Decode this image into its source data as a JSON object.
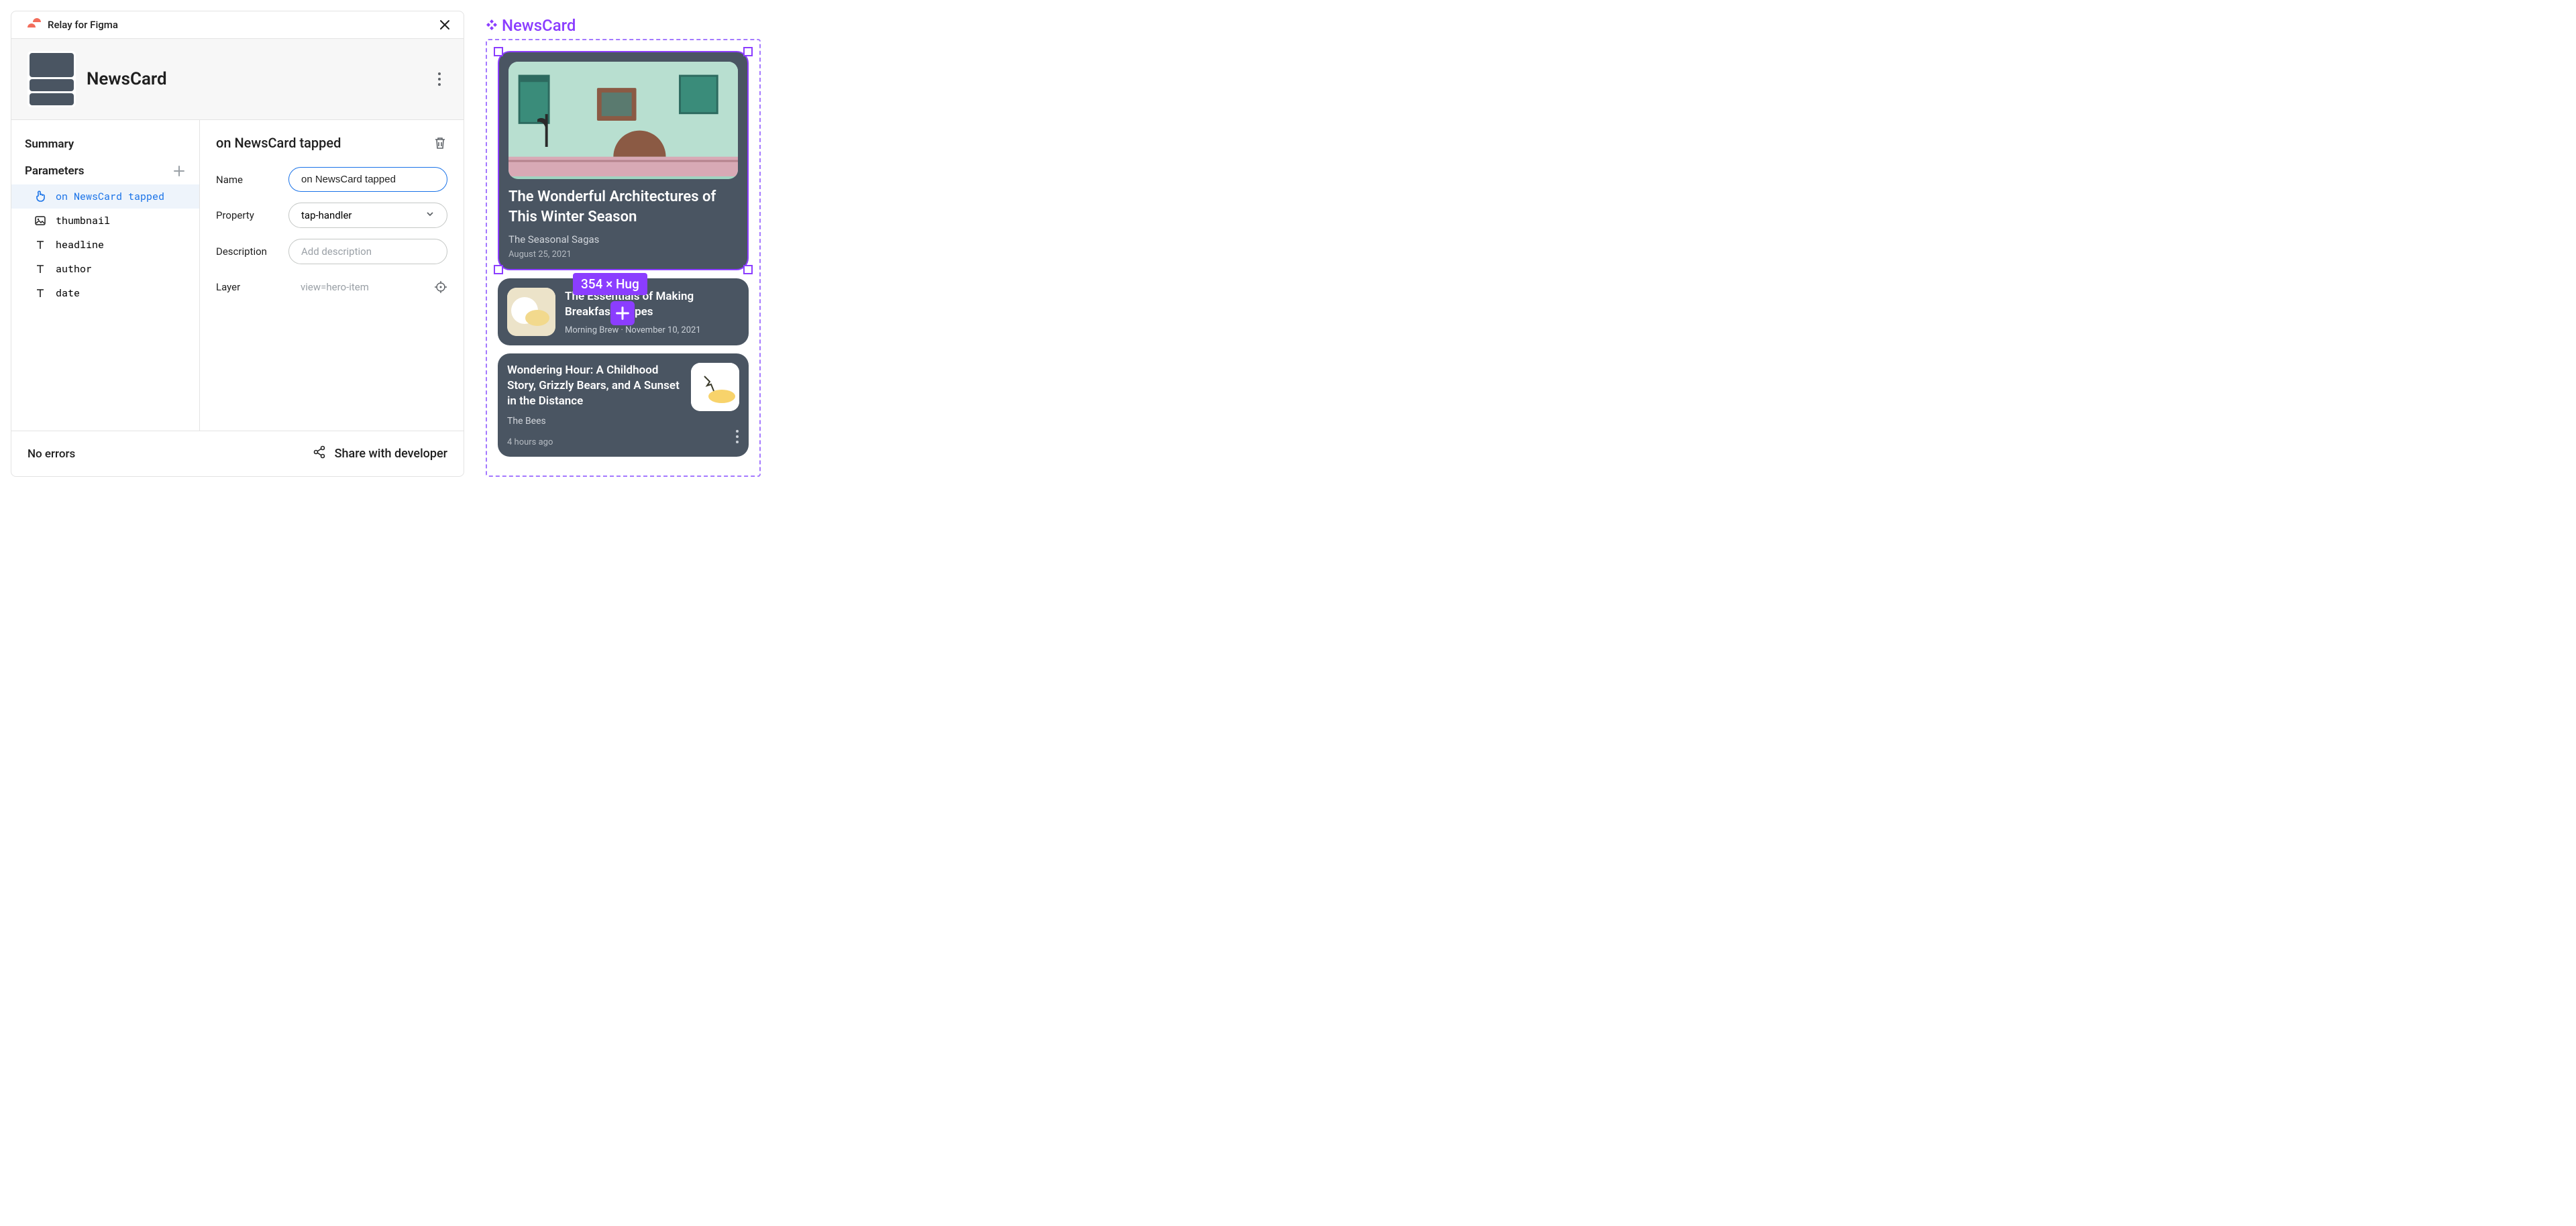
{
  "header": {
    "plugin_name": "Relay for Figma"
  },
  "component": {
    "name": "NewsCard"
  },
  "sidebar": {
    "summary_label": "Summary",
    "parameters_label": "Parameters",
    "params": [
      {
        "label": "on NewsCard tapped",
        "icon": "tap",
        "active": true
      },
      {
        "label": "thumbnail",
        "icon": "image",
        "active": false
      },
      {
        "label": "headline",
        "icon": "text",
        "active": false
      },
      {
        "label": "author",
        "icon": "text",
        "active": false
      },
      {
        "label": "date",
        "icon": "text",
        "active": false
      }
    ]
  },
  "detail": {
    "title": "on NewsCard tapped",
    "name_label": "Name",
    "name_value": "on NewsCard tapped",
    "property_label": "Property",
    "property_value": "tap-handler",
    "description_label": "Description",
    "description_placeholder": "Add description",
    "layer_label": "Layer",
    "layer_value": "view=hero-item"
  },
  "footer": {
    "status": "No errors",
    "share_label": "Share with developer"
  },
  "canvas": {
    "component_label": "NewsCard",
    "dimension_badge": "354 × Hug",
    "cards": [
      {
        "title": "The Wonderful Architectures of This Winter Season",
        "author": "The Seasonal Sagas",
        "date": "August 25, 2021"
      },
      {
        "title": "The Essentials of Making Breakfast Crepes",
        "subline": "Morning Brew · November 10, 2021"
      },
      {
        "title": "Wondering Hour: A Childhood Story, Grizzly Bears, and A Sunset in the Distance",
        "author": "The Bees",
        "timeago": "4 hours ago"
      }
    ]
  }
}
